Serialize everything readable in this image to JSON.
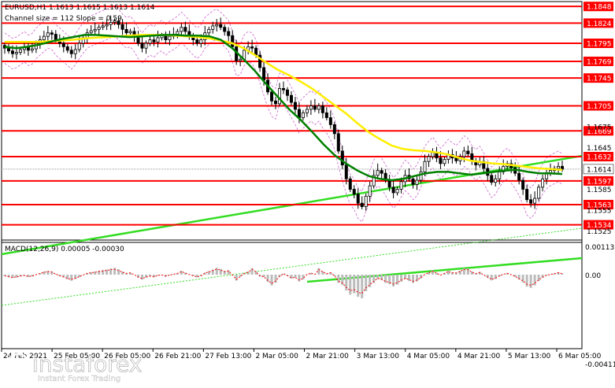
{
  "header": {
    "symbol_line": "EURUSD,H1  1.1613 1.1615 1.1613 1.1614",
    "channel_line": "Channel size = 112 Slope = 0.59"
  },
  "macd": {
    "label": "MACD(12,26,9) 0.00005 -0.00030",
    "scale_top": "0.00113",
    "scale_zero": "0.00",
    "scale_bottom": "-0.00411"
  },
  "watermark": {
    "brand": "instaforex",
    "tagline": "Instant Forex Trading"
  },
  "colors": {
    "level_line": "#ff0000",
    "level_label_bg": "#ff0000",
    "current_label_bg": "#ffffff",
    "ma_fast": "#008000",
    "ma_slow": "#ffee00",
    "channel": "#33dd22",
    "envelope": "#cc66cc",
    "candle": "#000000",
    "macd_hist": "#bbbbbb",
    "macd_signal": "#ff0000"
  },
  "chart_data": {
    "type": "candlestick",
    "symbol": "EURUSD",
    "timeframe": "H1",
    "ylim": [
      1.1512,
      1.1855
    ],
    "current_price": 1.1614,
    "price_levels": [
      1.1848,
      1.1824,
      1.1795,
      1.1769,
      1.1745,
      1.1705,
      1.1669,
      1.1632,
      1.1597,
      1.1563,
      1.1534
    ],
    "axis_ticks": [
      1.1675,
      1.1645,
      1.1585,
      1.1555,
      1.1525
    ],
    "time_labels": [
      "24 Feb 2021",
      "25 Feb 05:00",
      "26 Feb 05:00",
      "26 Feb 21:00",
      "27 Feb 13:00",
      "2 Mar 05:00",
      "2 Mar 21:00",
      "3 Mar 13:00",
      "4 Mar 05:00",
      "4 Mar 21:00",
      "5 Mar 13:00",
      "6 Mar 05:00"
    ],
    "close_series": [
      1.1788,
      1.1784,
      1.178,
      1.1782,
      1.1786,
      1.179,
      1.1785,
      1.1787,
      1.1795,
      1.18,
      1.1805,
      1.181,
      1.1808,
      1.18,
      1.1795,
      1.179,
      1.1785,
      1.178,
      1.1786,
      1.1795,
      1.1803,
      1.181,
      1.1813,
      1.1815,
      1.1818,
      1.182,
      1.1822,
      1.1825,
      1.1827,
      1.1822,
      1.1815,
      1.181,
      1.1812,
      1.1805,
      1.1795,
      1.1788,
      1.1795,
      1.18,
      1.1797,
      1.1803,
      1.1806,
      1.18,
      1.1805,
      1.1808,
      1.1812,
      1.1818,
      1.1812,
      1.1806,
      1.18,
      1.1795,
      1.18,
      1.181,
      1.1815,
      1.182,
      1.1822,
      1.1818,
      1.1812,
      1.1806,
      1.179,
      1.177,
      1.1772,
      1.1785,
      1.179,
      1.1788,
      1.1778,
      1.176,
      1.1742,
      1.1725,
      1.1712,
      1.1708,
      1.173,
      1.1728,
      1.172,
      1.171,
      1.17,
      1.1688,
      1.1695,
      1.17,
      1.1705,
      1.17,
      1.1705,
      1.1695,
      1.1688,
      1.1678,
      1.1665,
      1.164,
      1.162,
      1.16,
      1.1585,
      1.1578,
      1.1565,
      1.156,
      1.1575,
      1.159,
      1.1605,
      1.1612,
      1.1608,
      1.1598,
      1.1588,
      1.158,
      1.1585,
      1.1596,
      1.1605,
      1.16,
      1.1592,
      1.1598,
      1.161,
      1.1625,
      1.1632,
      1.1638,
      1.163,
      1.1622,
      1.1628,
      1.1635,
      1.163,
      1.1626,
      1.1632,
      1.164,
      1.1636,
      1.1626,
      1.162,
      1.1625,
      1.1615,
      1.1605,
      1.1595,
      1.16,
      1.161,
      1.1618,
      1.1622,
      1.1616,
      1.1608,
      1.1598,
      1.1585,
      1.157,
      1.1565,
      1.1572,
      1.1588,
      1.16,
      1.1608,
      1.1612,
      1.1615,
      1.1618,
      1.1614
    ],
    "ma_slow_series": [
      1.1797,
      1.1797,
      1.1797,
      1.1797,
      1.1798,
      1.1799,
      1.18,
      1.1802,
      1.1803,
      1.1804,
      1.1805,
      1.1806,
      1.1807,
      1.1807,
      1.1807,
      1.1806,
      1.1805,
      1.1804,
      1.1802,
      1.1799,
      1.1795,
      1.1788,
      1.1778,
      1.1767,
      1.1757,
      1.1749,
      1.174,
      1.173,
      1.1718,
      1.1706,
      1.1694,
      1.168,
      1.1667,
      1.1657,
      1.1648,
      1.1643,
      1.1641,
      1.164,
      1.1638,
      1.1635,
      1.163,
      1.1626,
      1.1624,
      1.1622,
      1.1621,
      1.1619,
      1.1617,
      1.1615,
      1.1614,
      1.1613
    ],
    "ma_fast_series": [
      1.179,
      1.1788,
      1.179,
      1.1793,
      1.1797,
      1.1801,
      1.1804,
      1.1807,
      1.1807,
      1.1806,
      1.1805,
      1.1804,
      1.1805,
      1.1806,
      1.1807,
      1.1807,
      1.1806,
      1.1806,
      1.1805,
      1.18,
      1.1788,
      1.1772,
      1.1755,
      1.1736,
      1.1718,
      1.17,
      1.1685,
      1.1668,
      1.165,
      1.1634,
      1.1622,
      1.1612,
      1.1604,
      1.16,
      1.1598,
      1.16,
      1.1604,
      1.1608,
      1.161,
      1.161,
      1.1608,
      1.1606,
      1.1608,
      1.161,
      1.1612,
      1.1613,
      1.161,
      1.1608,
      1.1608,
      1.1607
    ]
  }
}
